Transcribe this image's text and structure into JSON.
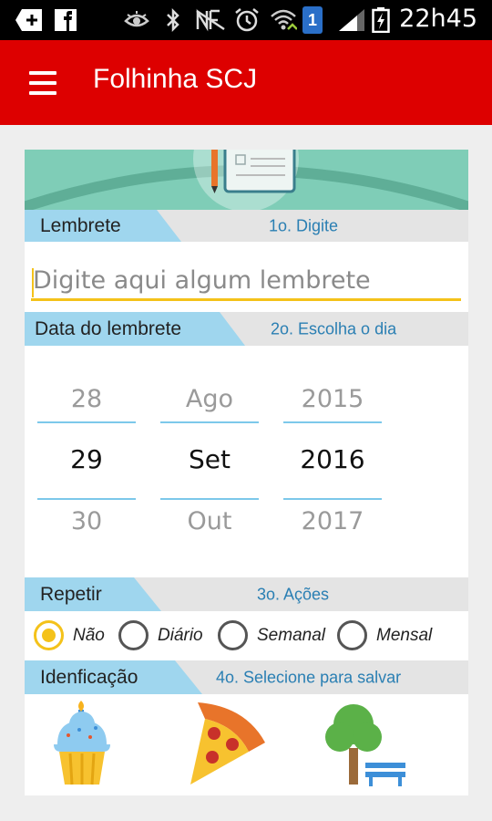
{
  "status_bar": {
    "time": "22h45",
    "sim_badge": "1",
    "icons": [
      "add-icon",
      "facebook-icon",
      "eye-icon",
      "bluetooth-icon",
      "nfc-icon",
      "alarm-icon",
      "wifi-icon",
      "signal-icon",
      "battery-charging-icon"
    ]
  },
  "app_bar": {
    "title": "Folhinha SCJ",
    "menu_icon": "hamburger-menu-icon",
    "color": "#dd0000"
  },
  "reminder_section": {
    "label": "Lembrete",
    "hint": "1o. Digite",
    "input_value": "",
    "input_placeholder": "Digite aqui algum lembrete"
  },
  "date_section": {
    "label": "Data do lembrete",
    "hint": "2o. Escolha o dia",
    "day": {
      "prev": "28",
      "selected": "29",
      "next": "30"
    },
    "month": {
      "prev": "Ago",
      "selected": "Set",
      "next": "Out"
    },
    "year": {
      "prev": "2015",
      "selected": "2016",
      "next": "2017"
    }
  },
  "repeat_section": {
    "label": "Repetir",
    "hint": "3o. Ações",
    "options": [
      "Não",
      "Diário",
      "Semanal",
      "Mensal"
    ],
    "selected": "Não"
  },
  "id_section": {
    "label": "Idenficação",
    "hint": "4o. Selecione para salvar",
    "icons": [
      "cupcake-icon",
      "pizza-icon",
      "tree-bench-icon"
    ]
  },
  "colors": {
    "tag": "#9fd6ee",
    "accent": "#f4c21a",
    "hint": "#2a7fb3",
    "picker_line": "#7cc8ea"
  }
}
